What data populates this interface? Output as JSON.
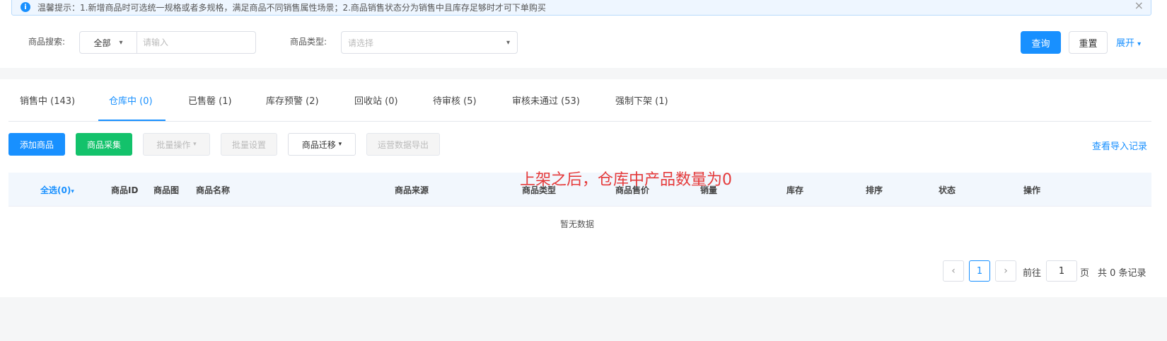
{
  "alert": {
    "icon": "info-icon",
    "text": "温馨提示：1.新增商品时可选统一规格或者多规格，满足商品不同销售属性场景；2.商品销售状态分为销售中且库存足够时才可下单购买"
  },
  "search": {
    "product_label": "商品搜索:",
    "scope_value": "全部",
    "keyword_placeholder": "请输入",
    "type_label": "商品类型:",
    "type_placeholder": "请选择",
    "query_label": "查询",
    "reset_label": "重置",
    "expand_label": "展开"
  },
  "tabs": [
    {
      "label": "销售中 (143)"
    },
    {
      "label": "仓库中 (0)"
    },
    {
      "label": "已售罄 (1)"
    },
    {
      "label": "库存预警 (2)"
    },
    {
      "label": "回收站 (0)"
    },
    {
      "label": "待审核 (5)"
    },
    {
      "label": "审核未通过 (53)"
    },
    {
      "label": "强制下架 (1)"
    }
  ],
  "active_tab": "仓库中 (0)",
  "toolbar": {
    "add_label": "添加商品",
    "collect_label": "商品采集",
    "batch_op_label": "批量操作",
    "batch_set_label": "批量设置",
    "migrate_label": "商品迁移",
    "export_label": "运营数据导出",
    "import_record_label": "查看导入记录"
  },
  "table": {
    "select_all": "全选(0)",
    "columns": [
      "商品ID",
      "商品图",
      "商品名称",
      "商品来源",
      "商品类型",
      "商品售价",
      "销量",
      "库存",
      "排序",
      "状态",
      "操作"
    ],
    "empty_text": "暂无数据"
  },
  "annotation": "上架之后，仓库中产品数量为0",
  "pagination": {
    "current_page": "1",
    "goto_label": "前往",
    "goto_value": "1",
    "page_unit": "页",
    "total_label": "共 0 条记录"
  },
  "colors": {
    "primary": "#1890ff",
    "success": "#13c26b",
    "annotation": "#e53a3a"
  }
}
